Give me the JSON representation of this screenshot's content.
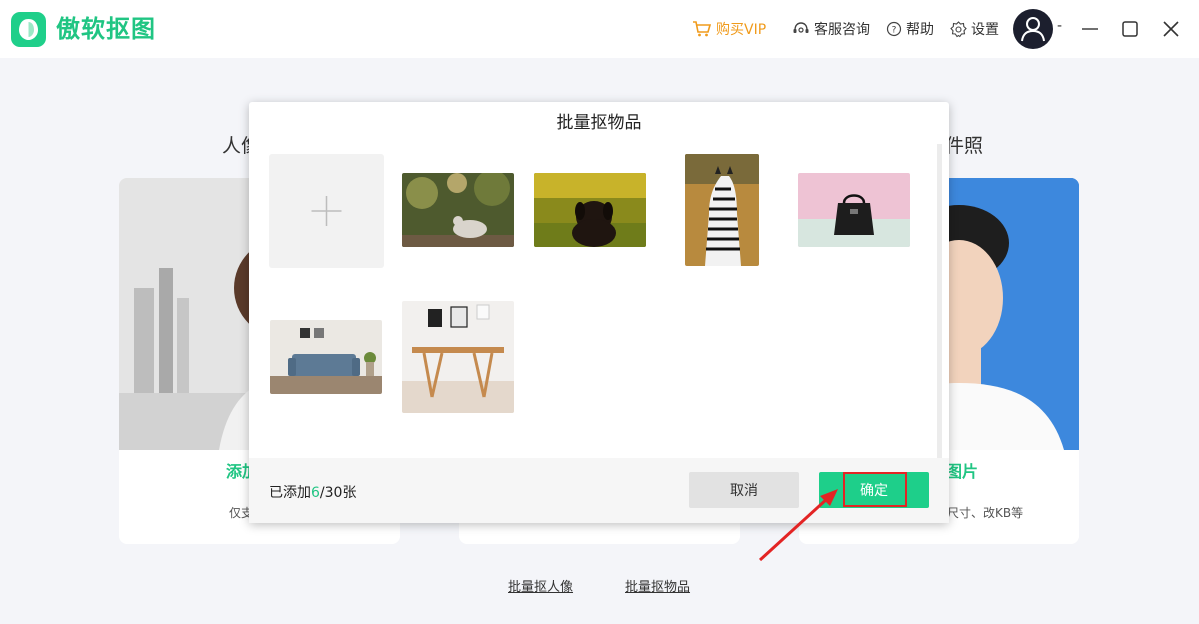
{
  "app": {
    "name": "傲软抠图"
  },
  "titlebar": {
    "vip": "购买VIP",
    "service": "客服咨询",
    "help": "帮助",
    "settings": "设置",
    "account_suffix": "-"
  },
  "background": {
    "left_heading_partial": "人像",
    "right_heading_partial": "件照",
    "left_card_title_partial": "添加",
    "left_card_desc_partial": "仅支",
    "right_card_title_partial": "图片",
    "right_card_desc_partial": "尺寸、改KB等",
    "batch_portrait_link": "批量抠人像",
    "batch_objects_link": "批量抠物品"
  },
  "modal": {
    "title": "批量抠物品",
    "thumbnails": [
      {
        "subject": "dove-photo"
      },
      {
        "subject": "black-dog-photo"
      },
      {
        "subject": "zebra-photo"
      },
      {
        "subject": "handbag-photo"
      },
      {
        "subject": "sofa-photo"
      },
      {
        "subject": "table-photo"
      }
    ],
    "added_prefix": "已添加",
    "added_count": "6",
    "added_suffix": "/30张",
    "cancel_label": "取消",
    "confirm_label": "确定"
  },
  "colors": {
    "brand_green": "#20c583",
    "vip_orange": "#f09b1c",
    "highlight_red": "#e32424"
  }
}
